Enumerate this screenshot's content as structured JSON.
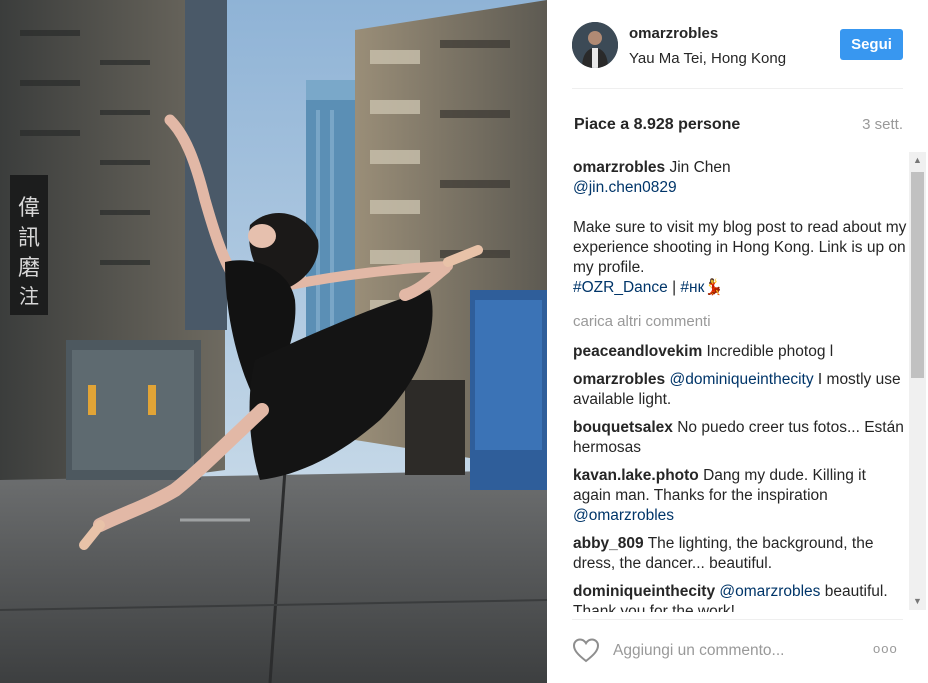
{
  "post": {
    "username": "omarzrobles",
    "location": "Yau Ma Tei, Hong Kong",
    "follow_label": "Segui",
    "likes": "Piace a 8.928 persone",
    "time": "3 sett.",
    "caption": {
      "user": "omarzrobles",
      "line1": " Jin Chen",
      "mention": "@jin.chen0829",
      "body": "Make sure to visit my blog post to read about my experience shooting in Hong Kong. Link is up on my profile.",
      "tag1": "#OZR_Dance",
      "sep": " | ",
      "tag2": "#нк💃"
    },
    "load_more": "carica altri commenti",
    "comments": [
      {
        "user": "peaceandlovekim",
        "mention": "",
        "text": " Incredible photog l"
      },
      {
        "user": "omarzrobles",
        "mention": " @dominiqueinthecity",
        "text": " I mostly use available light."
      },
      {
        "user": "bouquetsalex",
        "mention": "",
        "text": " No puedo creer tus fotos... Están hermosas"
      },
      {
        "user": "kavan.lake.photo",
        "mention": "",
        "text": " Dang my dude. Killing it again man. Thanks for the inspiration ",
        "mention_after": "@omarzrobles"
      },
      {
        "user": "abby_809",
        "mention": "",
        "text": " The lighting, the background, the dress, the dancer... beautiful."
      },
      {
        "user": "dominiqueinthecity",
        "mention": " @omarzrobles",
        "text": " beautiful. Thank you for the work!"
      }
    ],
    "comment_placeholder": "Aggiungi un commento...",
    "more_label": "ooo"
  },
  "icons": {
    "heart": "heart-icon",
    "scroll_up": "scroll-up-arrow-icon",
    "scroll_down": "scroll-down-arrow-icon"
  },
  "colors": {
    "follow_button": "#3897f0",
    "link": "#003569",
    "muted": "#999999"
  }
}
